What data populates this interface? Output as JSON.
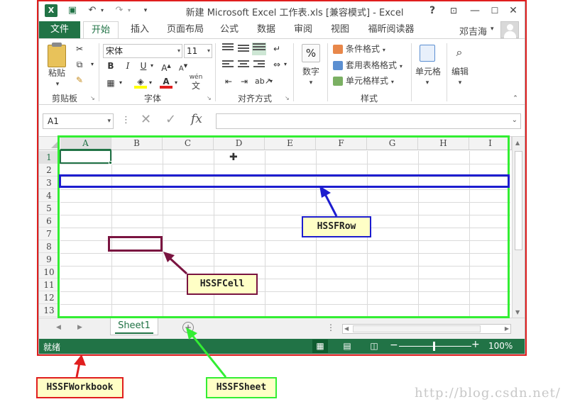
{
  "titlebar": {
    "app_icon": "excel-icon",
    "title": "新建 Microsoft Excel 工作表.xls  [兼容模式] - Excel",
    "help": "?"
  },
  "tabs": {
    "file": "文件",
    "items": [
      "开始",
      "插入",
      "页面布局",
      "公式",
      "数据",
      "审阅",
      "视图",
      "福昕阅读器"
    ],
    "user": "邓吉海"
  },
  "ribbon": {
    "clipboard": {
      "paste": "粘贴",
      "label": "剪贴板"
    },
    "font": {
      "name": "宋体",
      "size": "11",
      "label": "字体",
      "wen": "wén",
      "wen_char": "文"
    },
    "alignment": {
      "label": "对齐方式"
    },
    "number": {
      "button": "数字",
      "pct": "%"
    },
    "styles": {
      "conditional": "条件格式",
      "table": "套用表格格式",
      "cell_styles": "单元格样式",
      "label": "样式"
    },
    "cells": {
      "button": "单元格"
    },
    "editing": {
      "button": "编辑"
    }
  },
  "formula_bar": {
    "name_box": "A1",
    "formula": ""
  },
  "grid": {
    "columns": [
      "A",
      "B",
      "C",
      "D",
      "E",
      "F",
      "G",
      "H",
      "I"
    ],
    "rows": [
      "1",
      "2",
      "3",
      "4",
      "5",
      "6",
      "7",
      "8",
      "9",
      "10",
      "11",
      "12",
      "13"
    ],
    "active_cell": "A1"
  },
  "sheets": {
    "tabs": [
      "Sheet1"
    ],
    "add": "+"
  },
  "status": {
    "text": "就绪",
    "zoom": "100%"
  },
  "annotations": {
    "workbook": "HSSFWorkbook",
    "sheet": "HSSFSheet",
    "row": "HSSFRow",
    "cell": "HSSFCell"
  },
  "watermark": "http://blog.csdn.net/",
  "colors": {
    "excel_green": "#217346",
    "workbook": "#e01e1e",
    "sheet": "#33ee33",
    "row": "#1d1dcf",
    "cell": "#7a1440",
    "label_bg": "#ffffc6"
  }
}
